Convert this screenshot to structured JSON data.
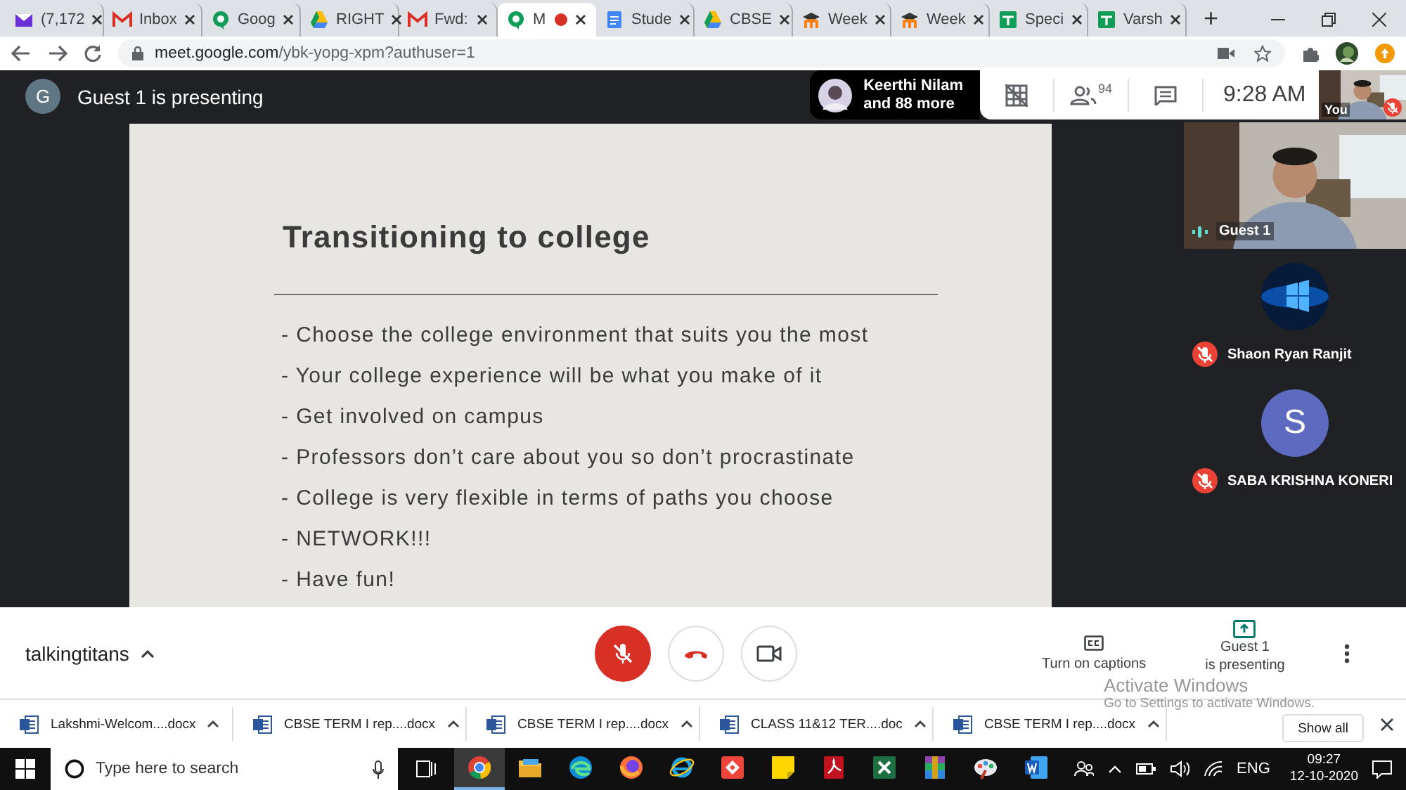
{
  "browser": {
    "tabs": [
      {
        "title": "(7,172",
        "kind": "mail",
        "selected": false
      },
      {
        "title": "Inbox",
        "kind": "gmail",
        "selected": false
      },
      {
        "title": "Goog",
        "kind": "bubble",
        "selected": false
      },
      {
        "title": "RIGHT",
        "kind": "drive",
        "selected": false
      },
      {
        "title": "Fwd:",
        "kind": "gmail",
        "selected": false
      },
      {
        "title": "M",
        "kind": "bubble",
        "selected": true,
        "recording": true
      },
      {
        "title": "Stude",
        "kind": "doc",
        "selected": false
      },
      {
        "title": "CBSE",
        "kind": "drive",
        "selected": false
      },
      {
        "title": "Week",
        "kind": "hat",
        "selected": false
      },
      {
        "title": "Week",
        "kind": "hat",
        "selected": false
      },
      {
        "title": "Speci",
        "kind": "sheet",
        "selected": false
      },
      {
        "title": "Varsh",
        "kind": "sheet",
        "selected": false
      }
    ],
    "new_tab": "+",
    "address": {
      "host": "meet.google.com",
      "path": "/ybk-yopg-xpm?authuser=1"
    }
  },
  "meet": {
    "presenter_avatar": "G",
    "presenter_label": "Guest 1 is presenting",
    "chip": {
      "line_1": "Keerthi Nilam",
      "line_2": "and 88 more"
    },
    "people_count": "94",
    "time": "9:28 AM",
    "self_tile": {
      "label": "You",
      "muted": true
    },
    "slide": {
      "title": "Transitioning to college",
      "bullets": [
        "- Choose the college environment that suits you the most",
        "- Your college experience will be what you make of it",
        "- Get involved on campus",
        "- Professors don’t care about you so don’t procrastinate",
        "- College is very flexible in terms of paths you choose",
        "- NETWORK!!!",
        "- Have fun!"
      ]
    },
    "participants": [
      {
        "name": "Guest 1",
        "kind": "video",
        "muted": false
      },
      {
        "name": "Shaon Ryan Ranjit",
        "muted": true
      },
      {
        "name": "SABA KRISHNA KONERI",
        "kind": "letter",
        "letter": "S",
        "muted": true
      }
    ]
  },
  "bottom_bar": {
    "meeting_name": "talkingtitans",
    "mic_on": false,
    "camera_on": true,
    "captions_label": "Turn on captions",
    "present_line_1": "Guest 1",
    "present_line_2": "is presenting"
  },
  "activation_notice": {
    "title": "Activate Windows",
    "subtitle": "Go to Settings to activate Windows."
  },
  "downloads": {
    "items": [
      "Lakshmi-Welcom....docx",
      "CBSE TERM I rep....docx",
      "CBSE TERM I rep....docx",
      "CLASS 11&12 TER....doc",
      "CBSE TERM I rep....docx"
    ],
    "show_all": "Show all"
  },
  "taskbar": {
    "search_placeholder": "Type here to search",
    "apps": [
      {
        "kind": "chrome",
        "selected": true
      },
      {
        "kind": "folder",
        "selected": false
      },
      {
        "kind": "edge",
        "selected": false
      },
      {
        "kind": "firefox",
        "selected": false
      },
      {
        "kind": "ie",
        "selected": false
      },
      {
        "kind": "remote",
        "selected": false
      },
      {
        "kind": "note",
        "selected": false
      },
      {
        "kind": "pdf",
        "selected": false
      },
      {
        "kind": "excel",
        "selected": false
      },
      {
        "kind": "archive",
        "selected": false
      },
      {
        "kind": "paint",
        "selected": false
      },
      {
        "kind": "word",
        "selected": false
      }
    ],
    "language": "ENG",
    "time": "09:27",
    "date": "12-10-2020"
  }
}
